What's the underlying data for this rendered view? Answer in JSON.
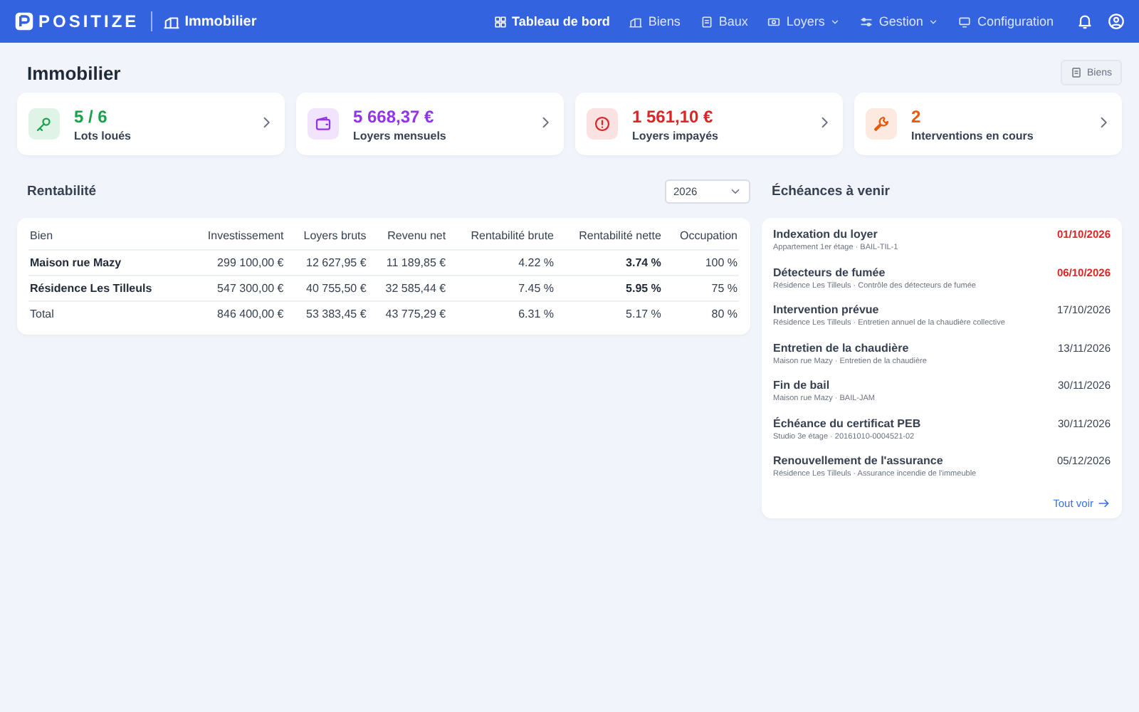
{
  "brand": {
    "name": "POSITIZE",
    "module": "Immobilier"
  },
  "nav": [
    {
      "label": "Tableau de bord",
      "selected": true,
      "dropdown": false
    },
    {
      "label": "Biens",
      "selected": false,
      "dropdown": false
    },
    {
      "label": "Baux",
      "selected": false,
      "dropdown": false
    },
    {
      "label": "Loyers",
      "selected": false,
      "dropdown": true
    },
    {
      "label": "Gestion",
      "selected": false,
      "dropdown": true
    },
    {
      "label": "Configuration",
      "selected": false,
      "dropdown": false
    }
  ],
  "page": {
    "title": "Immobilier",
    "action": "Biens"
  },
  "stats": [
    {
      "value": "5 / 6",
      "label": "Lots loués",
      "color": "#16a34a"
    },
    {
      "value": "5 668,37 €",
      "label": "Loyers mensuels",
      "color": "#9333ea"
    },
    {
      "value": "1 561,10 €",
      "label": "Loyers impayés",
      "color": "#dc2626"
    },
    {
      "value": "2",
      "label": "Interventions en cours",
      "color": "#ea580c"
    }
  ],
  "rentabilite": {
    "title": "Rentabilité",
    "year": "2026",
    "columns": [
      "Bien",
      "Investissement",
      "Loyers bruts",
      "Revenu net",
      "Rentabilité brute",
      "Rentabilité nette",
      "Occupation"
    ],
    "rows": [
      {
        "kind": "property",
        "cells": [
          "Maison rue Mazy",
          "299 100,00 €",
          "12 627,95 €",
          "11 189,85 €",
          "4.22 %",
          "3.74 %",
          "100 %"
        ]
      },
      {
        "kind": "property",
        "cells": [
          "Résidence Les Tilleuls",
          "547 300,00 €",
          "40 755,50 €",
          "32 585,44 €",
          "7.45 %",
          "5.95 %",
          "75 %"
        ]
      },
      {
        "kind": "total",
        "cells": [
          "Total",
          "846 400,00 €",
          "53 383,45 €",
          "43 775,29 €",
          "6.31 %",
          "5.17 %",
          "80 %"
        ]
      }
    ]
  },
  "echeances": {
    "title": "Échéances à venir",
    "link": "Tout voir",
    "items": [
      {
        "title": "Indexation du loyer",
        "detail": "Appartement 1er étage · BAIL-TIL-1",
        "date": "01/10/2026",
        "overdue": true
      },
      {
        "title": "Détecteurs de fumée",
        "detail": "Résidence Les Tilleuls · Contrôle des détecteurs de fumée",
        "date": "06/10/2026",
        "overdue": true
      },
      {
        "title": "Intervention prévue",
        "detail": "Résidence Les Tilleuls · Entretien annuel de la chaudière collective",
        "date": "17/10/2026",
        "overdue": false
      },
      {
        "title": "Entretien de la chaudière",
        "detail": "Maison rue Mazy · Entretien de la chaudière",
        "date": "13/11/2026",
        "overdue": false
      },
      {
        "title": "Fin de bail",
        "detail": "Maison rue Mazy · BAIL-JAM",
        "date": "30/11/2026",
        "overdue": false
      },
      {
        "title": "Échéance du certificat PEB",
        "detail": "Studio 3e étage · 20161010-0004521-02",
        "date": "30/11/2026",
        "overdue": false
      },
      {
        "title": "Renouvellement de l'assurance",
        "detail": "Résidence Les Tilleuls · Assurance incendie de l'immeuble",
        "date": "05/12/2026",
        "overdue": false
      }
    ]
  }
}
